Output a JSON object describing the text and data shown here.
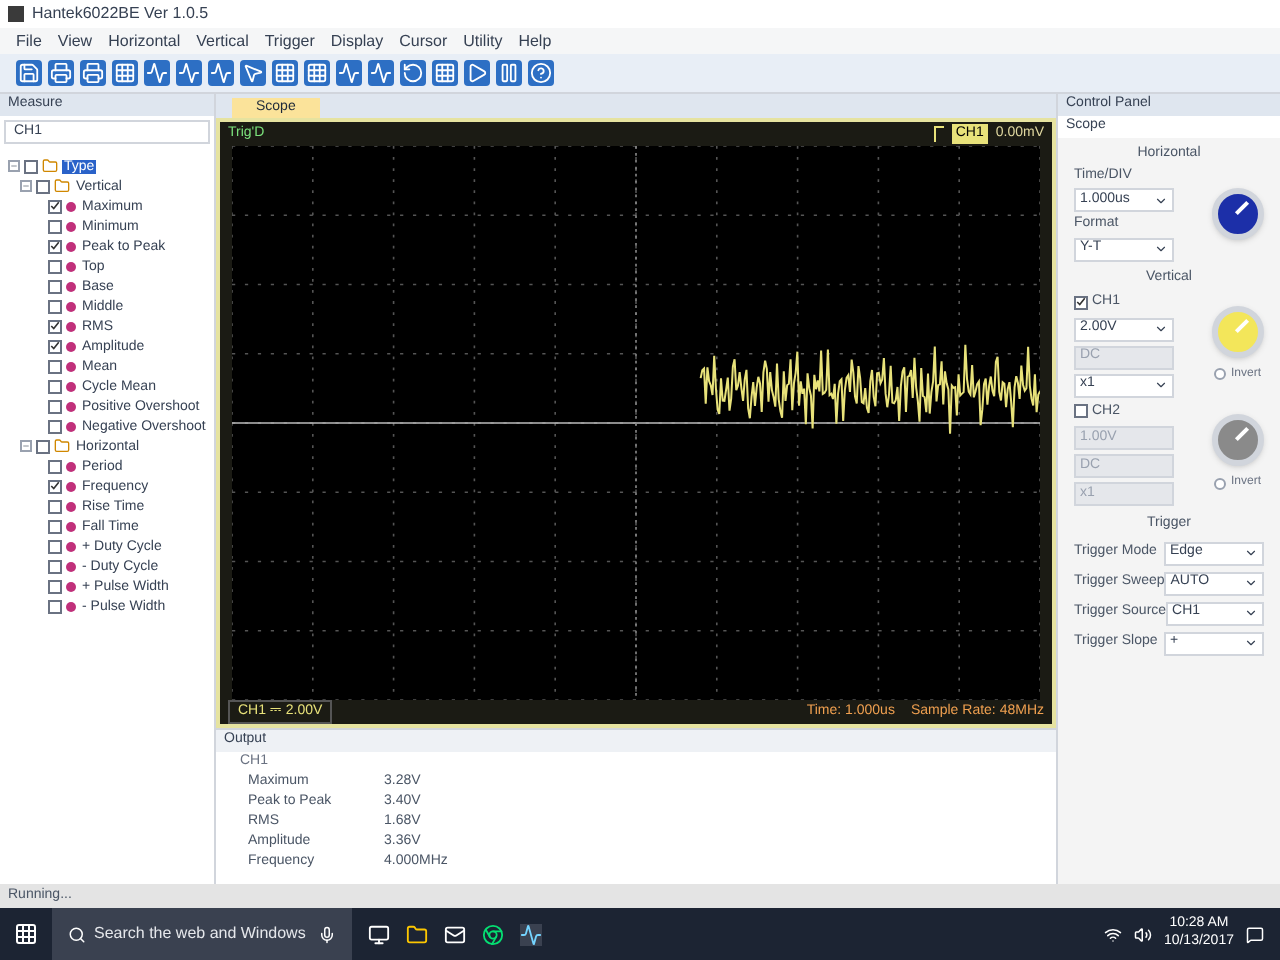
{
  "window": {
    "title": "Hantek6022BE Ver 1.0.5"
  },
  "menu": [
    "File",
    "View",
    "Horizontal",
    "Vertical",
    "Trigger",
    "Display",
    "Cursor",
    "Utility",
    "Help"
  ],
  "measure": {
    "title": "Measure",
    "channel": "CH1",
    "tree": [
      {
        "label": "Type",
        "kind": "group",
        "checked": false,
        "selected": true,
        "children": [
          {
            "label": "Vertical",
            "kind": "group",
            "checked": false,
            "selected": false,
            "children": [
              {
                "label": "Maximum",
                "kind": "item",
                "checked": true,
                "selected": false
              },
              {
                "label": "Minimum",
                "kind": "item",
                "checked": false,
                "selected": false
              },
              {
                "label": "Peak to Peak",
                "kind": "item",
                "checked": true,
                "selected": false
              },
              {
                "label": "Top",
                "kind": "item",
                "checked": false,
                "selected": false
              },
              {
                "label": "Base",
                "kind": "item",
                "checked": false,
                "selected": false
              },
              {
                "label": "Middle",
                "kind": "item",
                "checked": false,
                "selected": false
              },
              {
                "label": "RMS",
                "kind": "item",
                "checked": true,
                "selected": false
              },
              {
                "label": "Amplitude",
                "kind": "item",
                "checked": true,
                "selected": false
              },
              {
                "label": "Mean",
                "kind": "item",
                "checked": false,
                "selected": false
              },
              {
                "label": "Cycle Mean",
                "kind": "item",
                "checked": false,
                "selected": false
              },
              {
                "label": "Positive Overshoot",
                "kind": "item",
                "checked": false,
                "selected": false
              },
              {
                "label": "Negative Overshoot",
                "kind": "item",
                "checked": false,
                "selected": false
              }
            ]
          },
          {
            "label": "Horizontal",
            "kind": "group",
            "checked": false,
            "selected": false,
            "children": [
              {
                "label": "Period",
                "kind": "item",
                "checked": false,
                "selected": false
              },
              {
                "label": "Frequency",
                "kind": "item",
                "checked": true,
                "selected": false
              },
              {
                "label": "Rise Time",
                "kind": "item",
                "checked": false,
                "selected": false
              },
              {
                "label": "Fall Time",
                "kind": "item",
                "checked": false,
                "selected": false
              },
              {
                "label": "+ Duty Cycle",
                "kind": "item",
                "checked": false,
                "selected": false
              },
              {
                "label": "- Duty Cycle",
                "kind": "item",
                "checked": false,
                "selected": false
              },
              {
                "label": "+ Pulse Width",
                "kind": "item",
                "checked": false,
                "selected": false
              },
              {
                "label": "- Pulse Width",
                "kind": "item",
                "checked": false,
                "selected": false
              }
            ]
          }
        ]
      }
    ]
  },
  "scope": {
    "tab": "Scope",
    "status": "Trig'D",
    "trigger_channel": "CH1",
    "trigger_level": "0.00mV",
    "channel_readout": "CH1 ⎓ 2.00V",
    "time": "Time: 1.000us",
    "sample_rate": "Sample Rate: 48MHz"
  },
  "output": {
    "title": "Output",
    "channel": "CH1",
    "rows": [
      {
        "name": "Maximum",
        "value": "3.28V"
      },
      {
        "name": "Peak to Peak",
        "value": "3.40V"
      },
      {
        "name": "RMS",
        "value": "1.68V"
      },
      {
        "name": "Amplitude",
        "value": "3.36V"
      },
      {
        "name": "Frequency",
        "value": "4.000MHz"
      }
    ]
  },
  "control_panel": {
    "title": "Control Panel",
    "tab": "Scope",
    "horizontal": {
      "title": "Horizontal",
      "timediv_label": "Time/DIV",
      "timediv": "1.000us",
      "format_label": "Format",
      "format": "Y-T"
    },
    "vertical": {
      "title": "Vertical",
      "channels": [
        {
          "label": "CH1",
          "checked": true,
          "color": "#f3e65a",
          "volts": "2.00V",
          "coupling": "DC",
          "probe": "x1",
          "invert_label": "Invert",
          "invert": false
        },
        {
          "label": "CH2",
          "checked": false,
          "color": "#8a8a8a",
          "volts": "1.00V",
          "coupling": "DC",
          "probe": "x1",
          "invert_label": "Invert",
          "invert": false
        }
      ]
    },
    "trigger": {
      "title": "Trigger",
      "rows": [
        {
          "label": "Trigger Mode",
          "value": "Edge"
        },
        {
          "label": "Trigger Sweep",
          "value": "AUTO"
        },
        {
          "label": "Trigger Source",
          "value": "CH1"
        },
        {
          "label": "Trigger Slope",
          "value": "+"
        }
      ]
    }
  },
  "status_bar": "Running...",
  "taskbar": {
    "search_placeholder": "Search the web and Windows",
    "time": "10:28 AM",
    "date": "10/13/2017"
  }
}
